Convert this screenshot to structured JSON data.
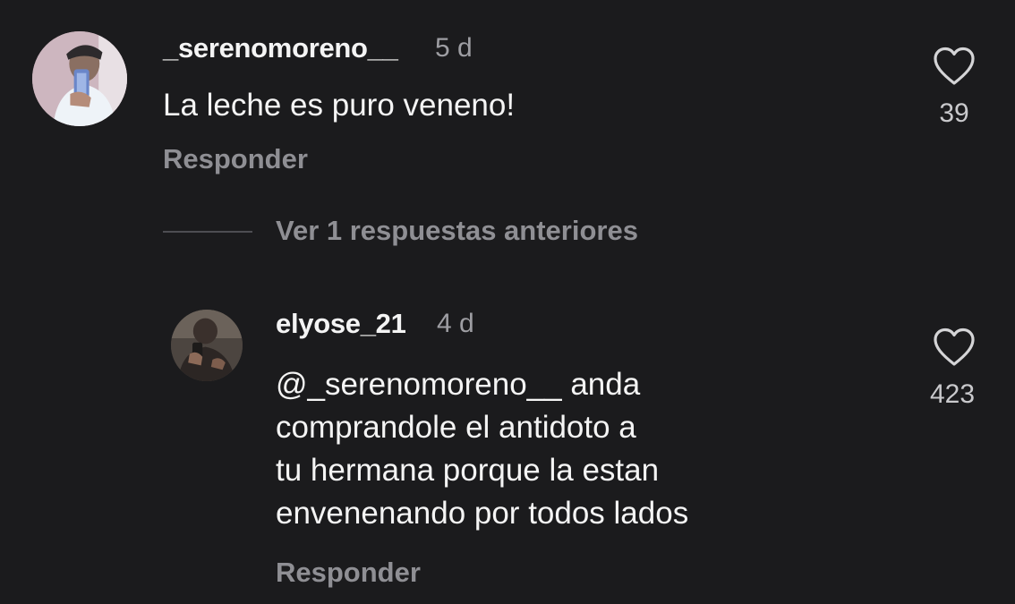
{
  "comments": [
    {
      "username": "_serenomoreno__",
      "time": "5 d",
      "text_lines": [
        "La leche es puro veneno!"
      ],
      "reply_label": "Responder",
      "likes": "39",
      "icons": {
        "avatar": "profile-photo",
        "like": "heart-outline-icon"
      }
    },
    {
      "username": "elyose_21",
      "time": "4 d",
      "text_lines": [
        "@_serenomoreno__ anda",
        "comprandole el antidoto a",
        "tu hermana porque la estan",
        "envenenando por todos lados"
      ],
      "reply_label": "Responder",
      "likes": "423",
      "icons": {
        "avatar": "profile-photo",
        "like": "heart-outline-icon"
      }
    }
  ],
  "view_replies_label": "Ver 1 respuestas anteriores",
  "colors": {
    "background": "#1b1b1d",
    "text_primary": "#f4f4f4",
    "text_secondary": "#8f8f94"
  }
}
